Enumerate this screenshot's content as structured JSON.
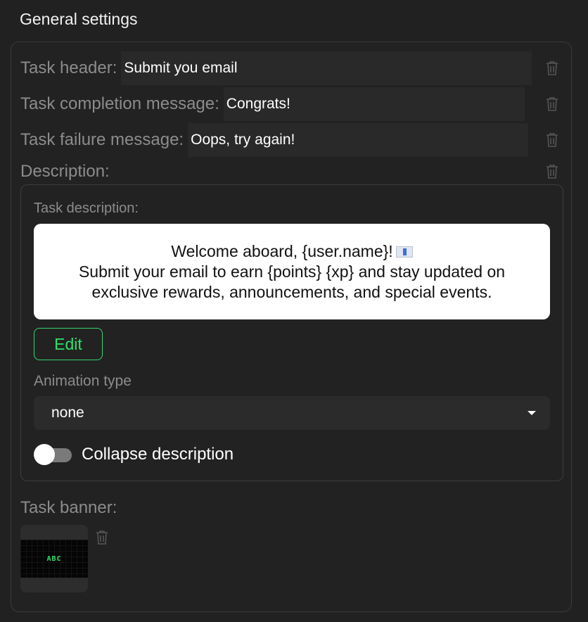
{
  "page": {
    "title": "General settings"
  },
  "fields": {
    "task_header": {
      "label": "Task header:",
      "value": "Submit you email"
    },
    "task_completion": {
      "label": "Task completion message:",
      "value": "Congrats!"
    },
    "task_failure": {
      "label": "Task failure message:",
      "value": "Oops, try again!"
    }
  },
  "description": {
    "label": "Description:",
    "task_description_label": "Task description:",
    "preview_line1": "Welcome aboard, {user.name}!",
    "preview_line2": "Submit your email to earn {points} {xp} and stay updated on",
    "preview_line3": "exclusive rewards, announcements, and special events.",
    "preview_emoji_icon": "envelope-icon",
    "edit_label": "Edit",
    "animation_label": "Animation type",
    "animation_value": "none",
    "collapse_label": "Collapse description",
    "collapse_enabled": false
  },
  "banner": {
    "label": "Task banner:",
    "image_text": "ABC"
  },
  "icons": {
    "delete": "trash-icon",
    "dropdown": "caret-down-icon"
  },
  "colors": {
    "accent": "#2ee26c",
    "background": "#212121",
    "input": "#292929",
    "muted_text": "#8c8c8c"
  }
}
